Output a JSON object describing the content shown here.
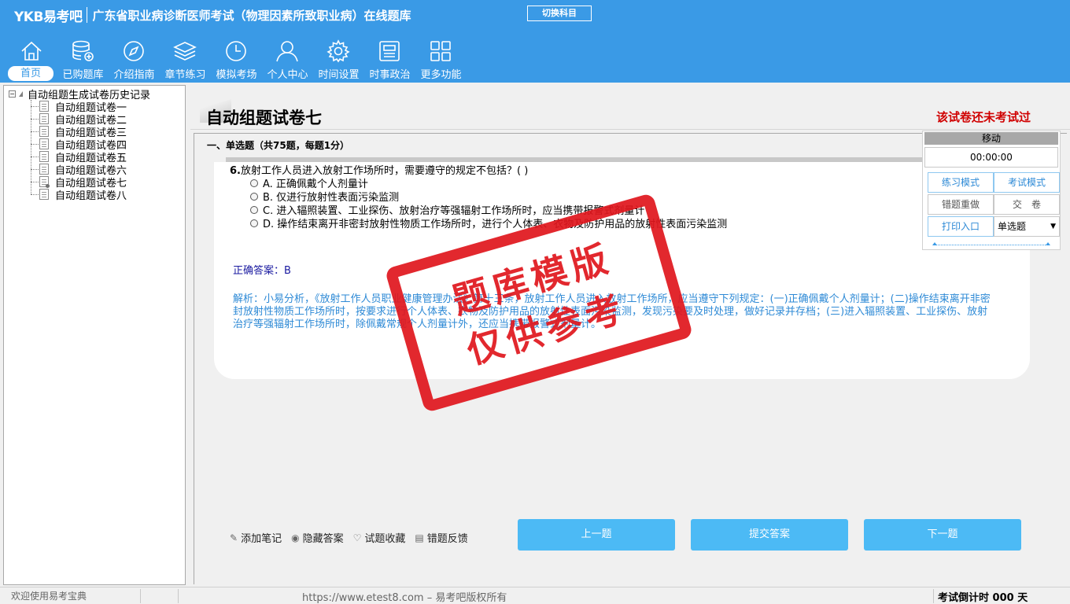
{
  "header": {
    "logo": "YKB易考吧",
    "title": "广东省职业病诊断医师考试（物理因素所致职业病）在线题库",
    "switch_button": "切换科目"
  },
  "nav": [
    {
      "label": "首页",
      "icon": "home-icon",
      "active": true
    },
    {
      "label": "已购题库",
      "icon": "database-icon"
    },
    {
      "label": "介绍指南",
      "icon": "compass-icon"
    },
    {
      "label": "章节练习",
      "icon": "layers-icon"
    },
    {
      "label": "模拟考场",
      "icon": "clock-icon"
    },
    {
      "label": "个人中心",
      "icon": "user-icon"
    },
    {
      "label": "时间设置",
      "icon": "gear-icon"
    },
    {
      "label": "时事政治",
      "icon": "newspaper-icon"
    },
    {
      "label": "更多功能",
      "icon": "grid-icon"
    }
  ],
  "tree": {
    "root": "自动组题生成试卷历史记录",
    "expander": "−",
    "items": [
      "自动组题试卷一",
      "自动组题试卷二",
      "自动组题试卷三",
      "自动组题试卷四",
      "自动组题试卷五",
      "自动组题试卷六",
      "自动组题试卷七",
      "自动组题试卷八"
    ],
    "selected_index": 6
  },
  "paper": {
    "title": "自动组题试卷七",
    "status": "该试卷还未考试过",
    "section": "一、单选题（共75题，每题1分）"
  },
  "question": {
    "number": "6.",
    "text": "放射工作人员进入放射工作场所时，需要遵守的规定不包括？( )",
    "options": [
      "A. 正确佩戴个人剂量计",
      "B. 仅进行放射性表面污染监测",
      "C. 进入辐照装置、工业探伤、放射治疗等强辐射工作场所时，应当携带报警式剂量计",
      "D. 操作结束离开非密封放射性物质工作场所时，进行个人体表、衣物及防护用品的放射性表面污染监测"
    ],
    "answer": "正确答案：B",
    "analysis": "解析：小易分析，《放射工作人员职业健康管理办法》第十三条，放射工作人员进入放射工作场所，应当遵守下列规定：(一)正确佩戴个人剂量计；(二)操作结束离开非密封放射性物质工作场所时，按要求进行个人体表、衣物及防护用品的放射性表面污染监测，发现污染要及时处理，做好记录并存档；(三)进入辐照装置、工业探伤、放射治疗等强辐射工作场所时，除佩戴常规个人剂量计外，还应当携带报警式剂量计。"
  },
  "tools": [
    {
      "label": "添加笔记",
      "icon": "pencil-icon",
      "glyph": "✎"
    },
    {
      "label": "隐藏答案",
      "icon": "eye-icon",
      "glyph": "◉"
    },
    {
      "label": "试题收藏",
      "icon": "heart-icon",
      "glyph": "♡"
    },
    {
      "label": "错题反馈",
      "icon": "feedback-icon",
      "glyph": "▤"
    }
  ],
  "buttons": {
    "prev": "上一题",
    "submit": "提交答案",
    "next": "下一题"
  },
  "stamp": {
    "line1": "题库模版",
    "line2": "仅供参考"
  },
  "float_panel": {
    "title": "移动",
    "timer": "00:00:00",
    "practice_mode": "练习模式",
    "exam_mode": "考试模式",
    "redo_wrong": "错题重做",
    "submit_paper": "交　卷",
    "print": "打印入口",
    "type_select": "单选题"
  },
  "status_bar": {
    "welcome": "欢迎使用易考宝典",
    "url": "https://www.etest8.com – 易考吧版权所有",
    "countdown": "考试倒计时 000 天"
  },
  "colors": {
    "header": "#3a9ae6",
    "button": "#4cbaf5",
    "stamp": "#e0161d",
    "status_red": "#d00000",
    "analysis": "#2e8ad6"
  }
}
